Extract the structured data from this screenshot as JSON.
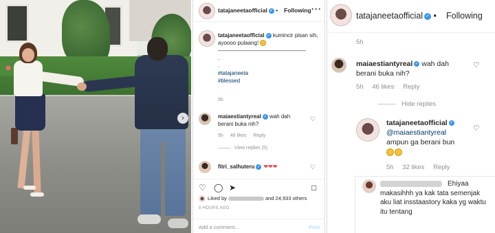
{
  "post": {
    "username": "tatajaneetaofficial",
    "follow_status": "Following",
    "more_icon": "more-icon",
    "caption": {
      "username": "tatajaneetaofficial",
      "text": "kumincir pisan sih, ayoooo pulaang!",
      "divider": "————————————————",
      "dot1": ".",
      "dot2": ".",
      "hashtag1": "#tatajaneeta",
      "hashtag2": "#blessed",
      "time": "5h"
    },
    "comments": [
      {
        "username": "maiaestiantyreal",
        "text": "wah dah berani buka nih?",
        "time": "5h",
        "likes": "46 likes",
        "reply": "Reply",
        "view_replies": "View replies (5)"
      },
      {
        "username": "fitri_salhuteru",
        "hearts": "❤❤❤"
      }
    ],
    "liked_by_prefix": "Liked by",
    "liked_by_suffix": "and 24,933 others",
    "time_ago": "5 HOURS AGO",
    "add_comment_placeholder": "Add a comment...",
    "post_label": "Post"
  },
  "zoom": {
    "username": "tatajaneetaofficial",
    "follow_status": "Following",
    "top_time": "5h",
    "comment1": {
      "username": "maiaestiantyreal",
      "text": "wah dah berani buka nih?",
      "time": "5h",
      "likes": "46 likes",
      "reply": "Reply",
      "hide_replies": "Hide replies"
    },
    "reply1": {
      "username": "tatajaneetaofficial",
      "mention": "@maiaestiantyreal",
      "text": "ampun ga berani bun",
      "time": "5h",
      "likes": "32 likes",
      "reply": "Reply"
    },
    "reply2": {
      "text": "Ehiyaa makasihhh ya kak tata semenjak aku liat insstaastory kaka yg waktu itu tentang",
      "cut_line": "..."
    }
  },
  "icons": {
    "verified": "verified-badge-icon",
    "heart": "heart-icon",
    "comment": "comment-icon",
    "share": "share-icon",
    "bookmark": "bookmark-icon",
    "next": "chevron-right-icon"
  },
  "colors": {
    "verified_blue": "#3897f0",
    "link_blue": "#00376b",
    "muted": "#8e8e8e",
    "heart_red": "#ed4956"
  }
}
